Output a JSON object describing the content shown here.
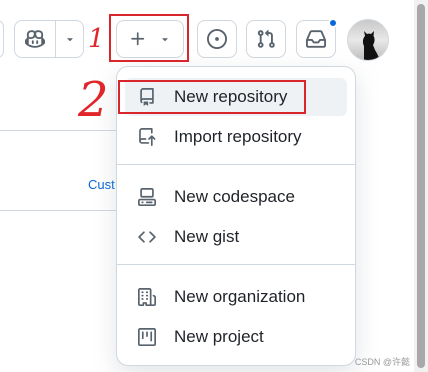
{
  "header": {
    "icons": {
      "copilot": "copilot-icon",
      "copilot_dropdown": "triangle-down-icon",
      "create": "plus-icon",
      "create_dropdown": "triangle-down-icon",
      "issues": "issue-opened-icon",
      "pull_requests": "git-pull-request-icon",
      "inbox": "inbox-icon",
      "avatar": "user-avatar"
    },
    "notification_indicator_color": "#0969da"
  },
  "annotations": {
    "one": "1",
    "two": "2",
    "color": "#d9262b"
  },
  "page": {
    "partial_link": "Cust"
  },
  "create_menu": {
    "items": [
      {
        "label": "New repository",
        "icon": "repo-icon"
      },
      {
        "label": "Import repository",
        "icon": "repo-push-icon"
      },
      {
        "label": "New codespace",
        "icon": "codespaces-icon"
      },
      {
        "label": "New gist",
        "icon": "code-icon"
      },
      {
        "label": "New organization",
        "icon": "organization-icon"
      },
      {
        "label": "New project",
        "icon": "project-icon"
      }
    ]
  },
  "watermark": "CSDN @许懿"
}
